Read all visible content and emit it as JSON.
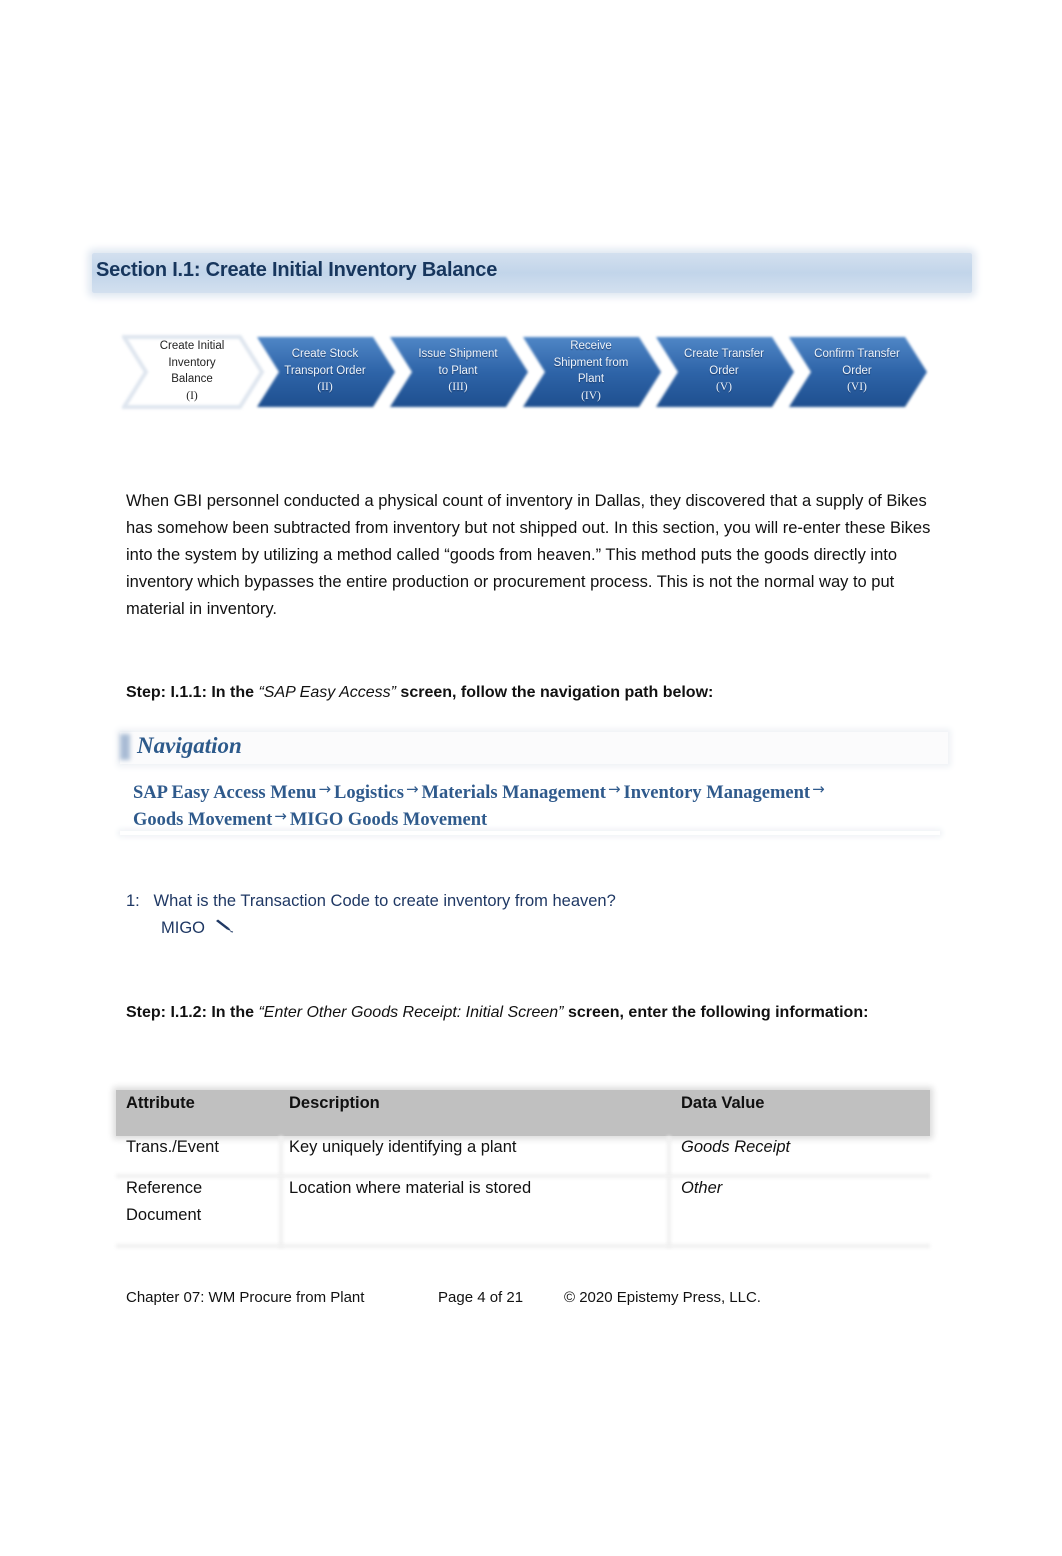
{
  "section": {
    "title": "Section I.1: Create Initial Inventory Balance"
  },
  "process_flow": [
    {
      "lines": [
        "Create Initial",
        "Inventory",
        "Balance"
      ],
      "numeral": "(I)",
      "active": true
    },
    {
      "lines": [
        "Create Stock",
        "Transport Order"
      ],
      "numeral": "(II)",
      "active": false
    },
    {
      "lines": [
        "Issue Shipment",
        "to Plant"
      ],
      "numeral": "(III)",
      "active": false
    },
    {
      "lines": [
        "Receive",
        "Shipment from",
        "Plant"
      ],
      "numeral": "(IV)",
      "active": false
    },
    {
      "lines": [
        "Create Transfer",
        "Order"
      ],
      "numeral": "(V)",
      "active": false
    },
    {
      "lines": [
        "Confirm Transfer",
        "Order"
      ],
      "numeral": "(VI)",
      "active": false
    }
  ],
  "intro_paragraph": "When GBI personnel conducted a physical count of inventory in Dallas, they discovered that a supply of Bikes has somehow been subtracted from inventory but not shipped out. In this section, you will re-enter these Bikes into the system by utilizing a method called “goods from heaven.” This method puts the goods directly into inventory which bypasses the entire production or procurement process. This is not the normal way to put material in inventory.",
  "step1": {
    "prefix": "Step: I.1.1: In the ",
    "screen": "“SAP Easy Access”",
    "suffix": " screen, follow the navigation path below:"
  },
  "navigation": {
    "title": "Navigation",
    "arrow": "→",
    "path": [
      "SAP Easy Access Menu",
      "Logistics",
      "Materials Management",
      "Inventory Management",
      "Goods Movement",
      "MIGO Goods Movement"
    ]
  },
  "question": {
    "number": "1:",
    "text": "What is the Transaction Code to create inventory from heaven?",
    "answer": "MIGO",
    "answer_icon": "pencil-icon"
  },
  "step2": {
    "prefix": "Step: I.1.2: In the ",
    "screen": "“Enter Other Goods Receipt: Initial Screen”",
    "suffix": " screen, enter the following information:"
  },
  "table": {
    "headers": [
      "Attribute",
      "Description",
      "Data Value"
    ],
    "rows": [
      {
        "attribute": "Trans./Event",
        "description": "Key uniquely identifying a plant",
        "value": "Goods Receipt"
      },
      {
        "attribute_lines": [
          "Reference",
          "Document"
        ],
        "description": "Location where material is stored",
        "value": "Other"
      }
    ]
  },
  "footer": {
    "chapter": "Chapter 07: WM Procure from Plant",
    "page": "Page 4 of 21",
    "copyright": "© 2020 Epistemy Press, LLC."
  },
  "colors": {
    "section_bg": "#c2d5ea",
    "section_text": "#17365d",
    "chevron_blue": "#2e64a8",
    "nav_text": "#2f5a8c",
    "question_text": "#1f3864",
    "table_header_bg": "#c0c0c0"
  }
}
